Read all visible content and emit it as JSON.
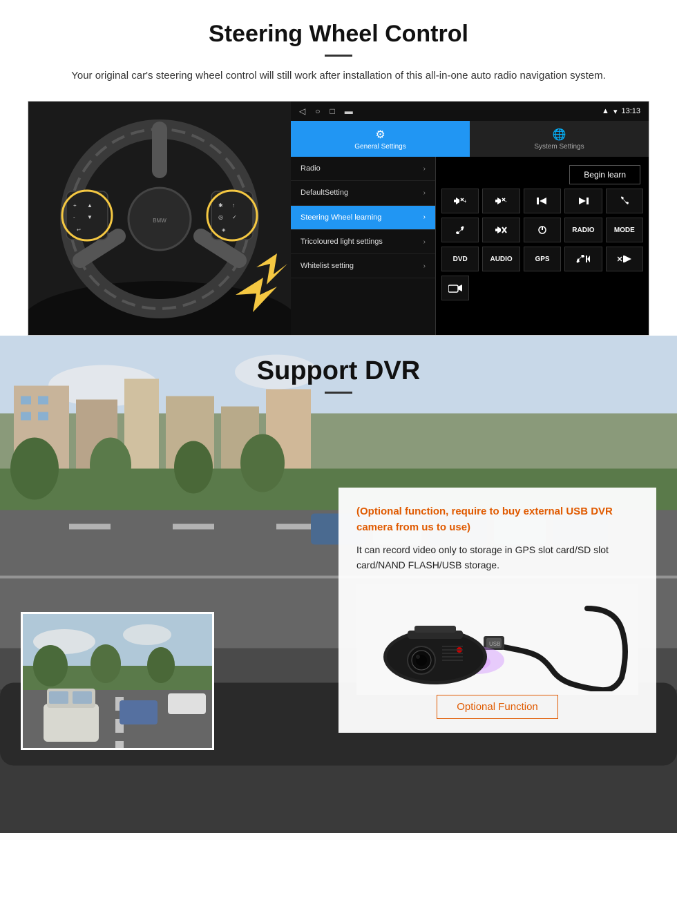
{
  "steering": {
    "title": "Steering Wheel Control",
    "subtitle": "Your original car's steering wheel control will still work after installation of this all-in-one auto radio navigation system.",
    "status_time": "13:13",
    "tabs": {
      "general": "General Settings",
      "system": "System Settings"
    },
    "menu_items": [
      {
        "label": "Radio",
        "active": false
      },
      {
        "label": "DefaultSetting",
        "active": false
      },
      {
        "label": "Steering Wheel learning",
        "active": true
      },
      {
        "label": "Tricoloured light settings",
        "active": false
      },
      {
        "label": "Whitelist setting",
        "active": false
      }
    ],
    "begin_learn": "Begin learn",
    "control_rows": [
      [
        "⏮+",
        "⏮-",
        "⏮",
        "⏭",
        "☎"
      ],
      [
        "↩",
        "🔇",
        "⏻",
        "RADIO",
        "MODE"
      ],
      [
        "DVD",
        "AUDIO",
        "GPS",
        "📞⏮",
        "✂⏭"
      ],
      [
        "📷"
      ]
    ]
  },
  "dvr": {
    "title": "Support DVR",
    "optional_text": "(Optional function, require to buy external USB DVR camera from us to use)",
    "description": "It can record video only to storage in GPS slot card/SD slot card/NAND FLASH/USB storage.",
    "optional_btn": "Optional Function"
  }
}
